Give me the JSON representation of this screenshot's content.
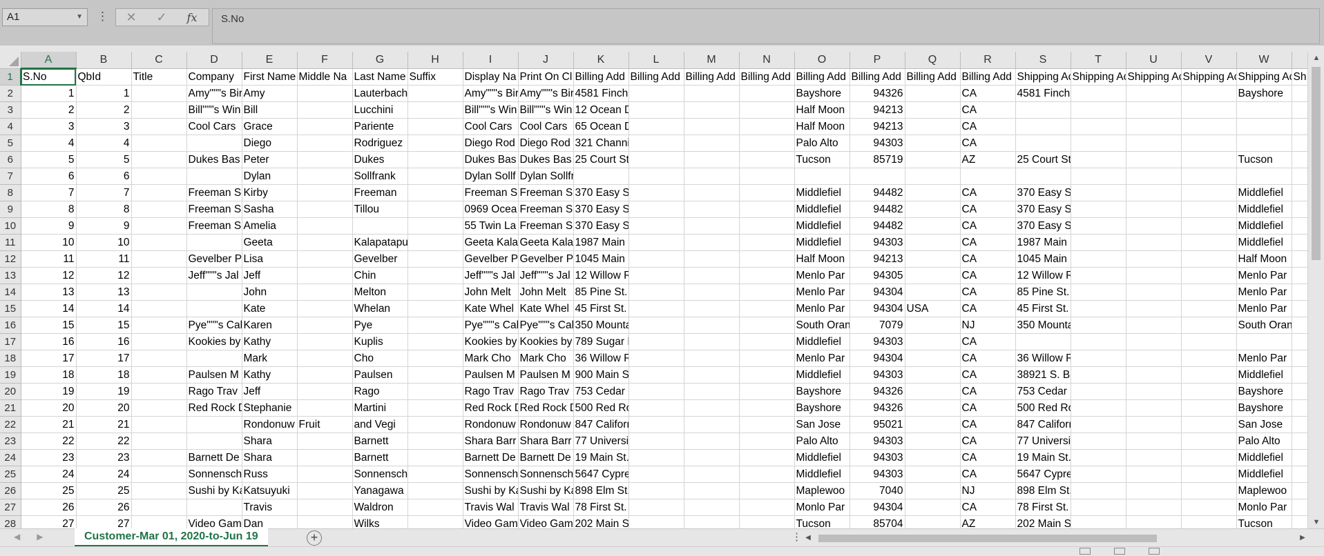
{
  "formula_bar": {
    "name_box": "A1",
    "cancel_symbol": "✕",
    "enter_symbol": "✓",
    "fx_symbol": "fx",
    "formula_value": "S.No"
  },
  "grid": {
    "columns": [
      "A",
      "B",
      "C",
      "D",
      "E",
      "F",
      "G",
      "H",
      "I",
      "J",
      "K",
      "L",
      "M",
      "N",
      "O",
      "P",
      "Q",
      "R",
      "S",
      "T",
      "U",
      "V",
      "W",
      "X"
    ],
    "selected_cell": "A1",
    "rows": [
      {
        "n": "1",
        "cells": [
          "S.No",
          "QbId",
          "Title",
          "Company",
          "First Name",
          "Middle Na",
          "Last Name",
          "Suffix",
          "Display Na",
          "Print On Cl",
          "Billing Add",
          "Billing Add",
          "Billing Add",
          "Billing Add",
          "Billing Add",
          "Billing Add",
          "Billing Add",
          "Billing Add",
          "Shipping Ac",
          "Shipping Ac",
          "Shipping Ac",
          "Shipping Ac",
          "Shipping Ac",
          "Sh"
        ]
      },
      {
        "n": "2",
        "cells": [
          "1",
          "1",
          "",
          "Amy\"\"\"s Bir",
          "Amy",
          "",
          "Lauterbach",
          "",
          "Amy\"\"\"s Bir",
          "Amy\"\"\"s Bir",
          "4581 Finch St.",
          "",
          "",
          "",
          "Bayshore",
          "94326",
          "",
          "CA",
          "4581 Finch St.",
          "",
          "",
          "",
          "Bayshore",
          ""
        ]
      },
      {
        "n": "3",
        "cells": [
          "2",
          "2",
          "",
          "Bill\"\"\"s Win",
          "Bill",
          "",
          "Lucchini",
          "",
          "Bill\"\"\"s Win",
          "Bill\"\"\"s Win",
          "12 Ocean Dr.",
          "",
          "",
          "",
          "Half Moon",
          "94213",
          "",
          "CA",
          "",
          "",
          "",
          "",
          "",
          ""
        ]
      },
      {
        "n": "4",
        "cells": [
          "3",
          "3",
          "",
          "Cool Cars",
          "Grace",
          "",
          "Pariente",
          "",
          "Cool Cars",
          "Cool Cars",
          "65 Ocean Dr.",
          "",
          "",
          "",
          "Half Moon",
          "94213",
          "",
          "CA",
          "",
          "",
          "",
          "",
          "",
          ""
        ]
      },
      {
        "n": "5",
        "cells": [
          "4",
          "4",
          "",
          "",
          "Diego",
          "",
          "Rodriguez",
          "",
          "Diego Rod",
          "Diego Rod",
          "321 Channing",
          "",
          "",
          "",
          "Palo Alto",
          "94303",
          "",
          "CA",
          "",
          "",
          "",
          "",
          "",
          ""
        ]
      },
      {
        "n": "6",
        "cells": [
          "5",
          "5",
          "",
          "Dukes Bas",
          "Peter",
          "",
          "Dukes",
          "",
          "Dukes Bas",
          "Dukes Bas",
          "25 Court St.",
          "",
          "",
          "",
          "Tucson",
          "85719",
          "",
          "AZ",
          "25 Court St.",
          "",
          "",
          "",
          "Tucson",
          ""
        ]
      },
      {
        "n": "7",
        "cells": [
          "6",
          "6",
          "",
          "",
          "Dylan",
          "",
          "Sollfrank",
          "",
          "Dylan Sollf",
          "Dylan Sollfrank",
          "",
          "",
          "",
          "",
          "",
          "",
          "",
          "",
          "",
          "",
          "",
          "",
          "",
          ""
        ]
      },
      {
        "n": "8",
        "cells": [
          "7",
          "7",
          "",
          "Freeman S",
          "Kirby",
          "",
          "Freeman",
          "",
          "Freeman S",
          "Freeman S",
          "370 Easy St.",
          "",
          "",
          "",
          "Middlefiel",
          "94482",
          "",
          "CA",
          "370 Easy St.",
          "",
          "",
          "",
          "Middlefiel",
          ""
        ]
      },
      {
        "n": "9",
        "cells": [
          "8",
          "8",
          "",
          "Freeman S",
          "Sasha",
          "",
          "Tillou",
          "",
          "0969 Ocea",
          "Freeman S",
          "370 Easy St.",
          "",
          "",
          "",
          "Middlefiel",
          "94482",
          "",
          "CA",
          "370 Easy St.",
          "",
          "",
          "",
          "Middlefiel",
          ""
        ]
      },
      {
        "n": "10",
        "cells": [
          "9",
          "9",
          "",
          "Freeman S",
          "Amelia",
          "",
          "",
          "",
          "55 Twin La",
          "Freeman S",
          "370 Easy St.",
          "",
          "",
          "",
          "Middlefiel",
          "94482",
          "",
          "CA",
          "370 Easy St.",
          "",
          "",
          "",
          "Middlefiel",
          ""
        ]
      },
      {
        "n": "11",
        "cells": [
          "10",
          "10",
          "",
          "",
          "Geeta",
          "",
          "Kalapatapu",
          "",
          "Geeta Kala",
          "Geeta Kala",
          "1987 Main St.",
          "",
          "",
          "",
          "Middlefiel",
          "94303",
          "",
          "CA",
          "1987 Main St.",
          "",
          "",
          "",
          "Middlefiel",
          ""
        ]
      },
      {
        "n": "12",
        "cells": [
          "11",
          "11",
          "",
          "Gevelber P",
          "Lisa",
          "",
          "Gevelber",
          "",
          "Gevelber P",
          "Gevelber P",
          "1045 Main St.",
          "",
          "",
          "",
          "Half Moon",
          "94213",
          "",
          "CA",
          "1045 Main St.",
          "",
          "",
          "",
          "Half Moon",
          ""
        ]
      },
      {
        "n": "13",
        "cells": [
          "12",
          "12",
          "",
          "Jeff\"\"\"s Jal",
          "Jeff",
          "",
          "Chin",
          "",
          "Jeff\"\"\"s Jal",
          "Jeff\"\"\"s Jal",
          "12 Willow Rd.",
          "",
          "",
          "",
          "Menlo Par",
          "94305",
          "",
          "CA",
          "12 Willow Rd.",
          "",
          "",
          "",
          "Menlo Par",
          ""
        ]
      },
      {
        "n": "14",
        "cells": [
          "13",
          "13",
          "",
          "",
          "John",
          "",
          "Melton",
          "",
          "John Melt",
          "John Melt",
          "85 Pine St.",
          "",
          "",
          "",
          "Menlo Par",
          "94304",
          "",
          "CA",
          "85 Pine St.",
          "",
          "",
          "",
          "Menlo Par",
          ""
        ]
      },
      {
        "n": "15",
        "cells": [
          "14",
          "14",
          "",
          "",
          "Kate",
          "",
          "Whelan",
          "",
          "Kate Whel",
          "Kate Whel",
          "45 First St.",
          "",
          "",
          "",
          "Menlo Par",
          "94304",
          "USA",
          "CA",
          "45 First St.",
          "",
          "",
          "",
          "Menlo Par",
          ""
        ]
      },
      {
        "n": "16",
        "cells": [
          "15",
          "15",
          "",
          "Pye\"\"\"s Cal",
          "Karen",
          "",
          "Pye",
          "",
          "Pye\"\"\"s Cal",
          "Pye\"\"\"s Cal",
          "350 Mountain View Dr.",
          "",
          "",
          "",
          "South Oran",
          "7079",
          "",
          "NJ",
          "350 Mountain View Dr.",
          "",
          "",
          "",
          "South Oran",
          ""
        ]
      },
      {
        "n": "17",
        "cells": [
          "16",
          "16",
          "",
          "Kookies by",
          "Kathy",
          "",
          "Kuplis",
          "",
          "Kookies by",
          "Kookies by",
          "789 Sugar Lane",
          "",
          "",
          "",
          "Middlefiel",
          "94303",
          "",
          "CA",
          "",
          "",
          "",
          "",
          "",
          ""
        ]
      },
      {
        "n": "18",
        "cells": [
          "17",
          "17",
          "",
          "",
          "Mark",
          "",
          "Cho",
          "",
          "Mark Cho",
          "Mark Cho",
          "36 Willow Rd",
          "",
          "",
          "",
          "Menlo Par",
          "94304",
          "",
          "CA",
          "36 Willow Rd",
          "",
          "",
          "",
          "Menlo Par",
          ""
        ]
      },
      {
        "n": "19",
        "cells": [
          "18",
          "18",
          "",
          "Paulsen M",
          "Kathy",
          "",
          "Paulsen",
          "",
          "Paulsen M",
          "Paulsen M",
          "900 Main St.",
          "",
          "",
          "",
          "Middlefiel",
          "94303",
          "",
          "CA",
          "38921 S. Boise Ave",
          "",
          "",
          "",
          "Middlefiel",
          ""
        ]
      },
      {
        "n": "20",
        "cells": [
          "19",
          "19",
          "",
          "Rago Trav",
          "Jeff",
          "",
          "Rago",
          "",
          "Rago Trav",
          "Rago Trav",
          "753 Cedar St.",
          "",
          "",
          "",
          "Bayshore",
          "94326",
          "",
          "CA",
          "753 Cedar St.",
          "",
          "",
          "",
          "Bayshore",
          ""
        ]
      },
      {
        "n": "21",
        "cells": [
          "20",
          "20",
          "",
          "Red Rock D",
          "Stephanie",
          "",
          "Martini",
          "",
          "Red Rock D",
          "Red Rock D",
          "500 Red Rock Rd.",
          "",
          "",
          "",
          "Bayshore",
          "94326",
          "",
          "CA",
          "500 Red Rock Rd.",
          "",
          "",
          "",
          "Bayshore",
          ""
        ]
      },
      {
        "n": "22",
        "cells": [
          "21",
          "21",
          "",
          "",
          "Rondonuw",
          "Fruit",
          "and Vegi",
          "",
          "Rondonuw",
          "Rondonuw",
          "847 California Ave.",
          "",
          "",
          "",
          "San Jose",
          "95021",
          "",
          "CA",
          "847 California Ave.",
          "",
          "",
          "",
          "San Jose",
          ""
        ]
      },
      {
        "n": "23",
        "cells": [
          "22",
          "22",
          "",
          "",
          "Shara",
          "",
          "Barnett",
          "",
          "Shara Barr",
          "Shara Barr",
          "77 University",
          "",
          "",
          "",
          "Palo Alto",
          "94303",
          "",
          "CA",
          "77 University",
          "",
          "",
          "",
          "Palo Alto",
          ""
        ]
      },
      {
        "n": "24",
        "cells": [
          "23",
          "23",
          "",
          "Barnett De",
          "Shara",
          "",
          "Barnett",
          "",
          "Barnett De",
          "Barnett De",
          "19 Main St.",
          "",
          "",
          "",
          "Middlefiel",
          "94303",
          "",
          "CA",
          "19 Main St.",
          "",
          "",
          "",
          "Middlefiel",
          ""
        ]
      },
      {
        "n": "25",
        "cells": [
          "24",
          "24",
          "",
          "Sonnensch",
          "Russ",
          "",
          "Sonnenschein",
          "",
          "Sonnensch",
          "Sonnensch",
          "5647 Cypress Hill Ave.",
          "",
          "",
          "",
          "Middlefiel",
          "94303",
          "",
          "CA",
          "5647 Cypress Hill Ave.",
          "",
          "",
          "",
          "Middlefiel",
          ""
        ]
      },
      {
        "n": "26",
        "cells": [
          "25",
          "25",
          "",
          "Sushi by Ka",
          "Katsuyuki",
          "",
          "Yanagawa",
          "",
          "Sushi by Ka",
          "Sushi by Ka",
          "898 Elm St.",
          "",
          "",
          "",
          "Maplewoo",
          "7040",
          "",
          "NJ",
          "898 Elm St.",
          "",
          "",
          "",
          "Maplewoo",
          ""
        ]
      },
      {
        "n": "27",
        "cells": [
          "26",
          "26",
          "",
          "",
          "Travis",
          "",
          "Waldron",
          "",
          "Travis Wal",
          "Travis Wal",
          "78 First St.",
          "",
          "",
          "",
          "Monlo Par",
          "94304",
          "",
          "CA",
          "78 First St.",
          "",
          "",
          "",
          "Monlo Par",
          ""
        ]
      },
      {
        "n": "28",
        "cells": [
          "27",
          "27",
          "",
          "Video Gam",
          "Dan",
          "",
          "Wilks",
          "",
          "Video Gam",
          "Video Gam",
          "202 Main St.",
          "",
          "",
          "",
          "Tucson",
          "85704",
          "",
          "AZ",
          "202 Main St.",
          "",
          "",
          "",
          "Tucson",
          ""
        ]
      }
    ]
  },
  "sheet_tabs": {
    "active": "Customer-Mar 01, 2020-to-Jun 19",
    "add_symbol": "+",
    "options_symbol": "⋮"
  }
}
